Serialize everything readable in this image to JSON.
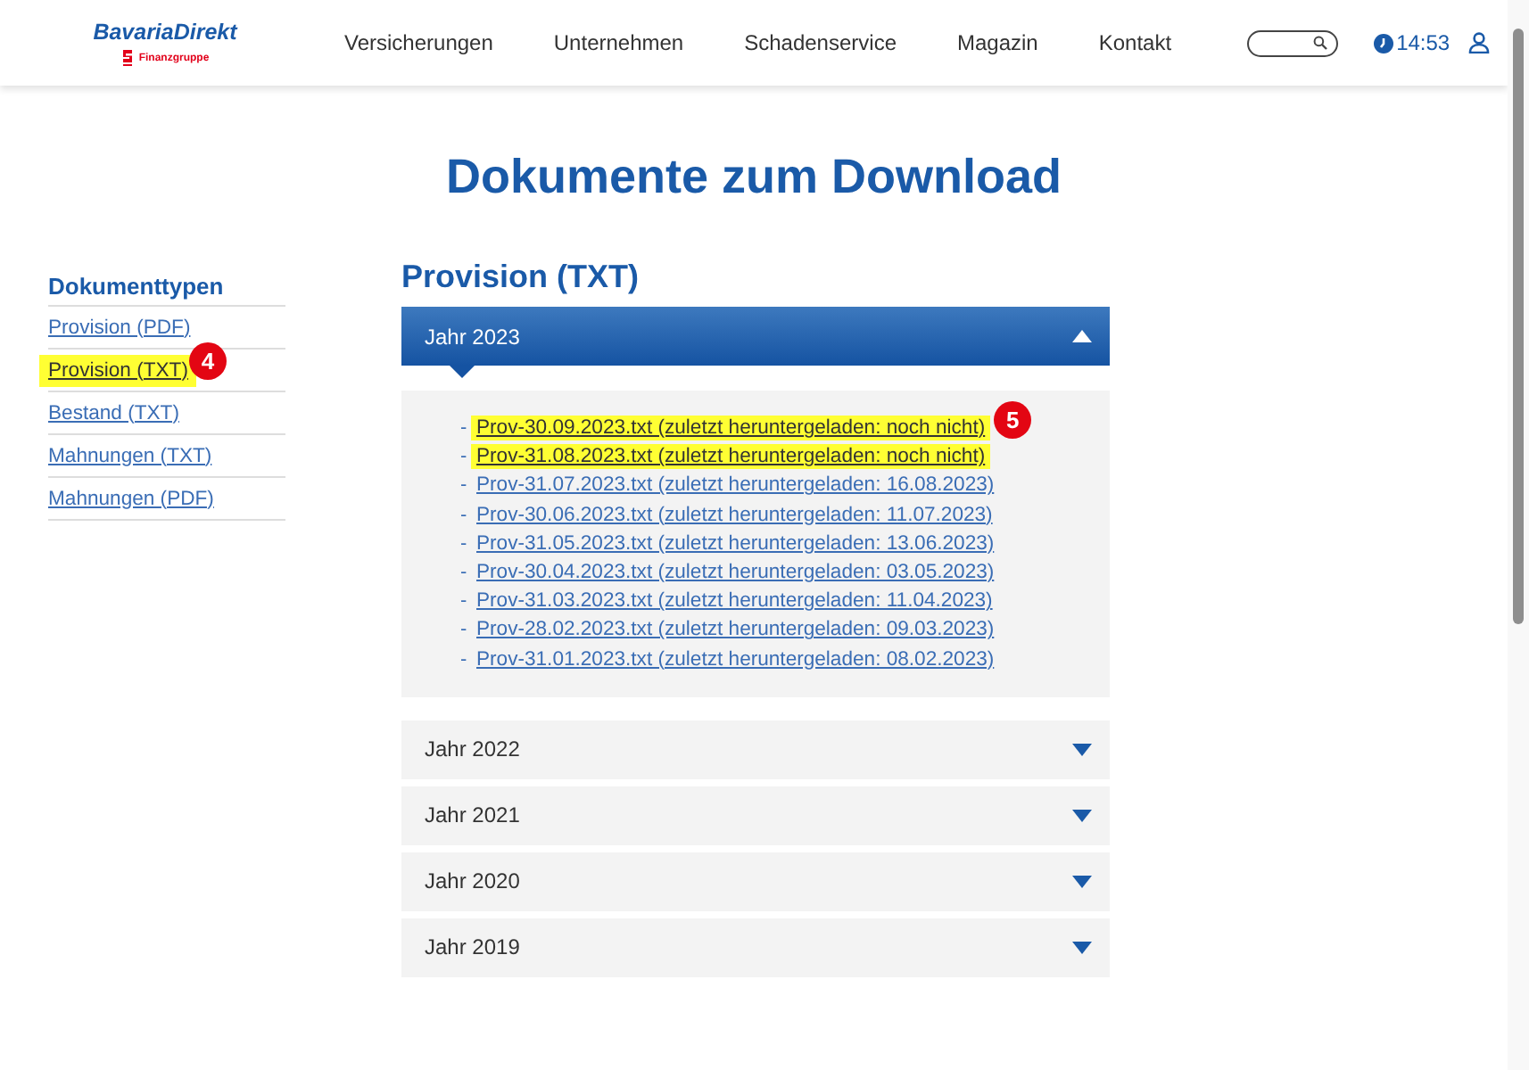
{
  "header": {
    "logo": {
      "name": "BavariaDirekt",
      "sub": "Finanzgruppe"
    },
    "nav": [
      "Versicherungen",
      "Unternehmen",
      "Schadenservice",
      "Magazin",
      "Kontakt"
    ],
    "time": "14:53"
  },
  "title": "Dokumente zum Download",
  "sidebar": {
    "heading": "Dokumenttypen",
    "items": [
      {
        "label": "Provision (PDF)",
        "highlighted": false
      },
      {
        "label": "Provision (TXT)",
        "highlighted": true,
        "badge": "4"
      },
      {
        "label": "Bestand (TXT)",
        "highlighted": false
      },
      {
        "label": "Mahnungen (TXT)",
        "highlighted": false
      },
      {
        "label": "Mahnungen (PDF)",
        "highlighted": false
      }
    ]
  },
  "section_title": "Provision (TXT)",
  "years": [
    {
      "label": "Jahr 2023",
      "expanded": true,
      "marker": "-",
      "files": [
        {
          "label": "Prov-30.09.2023.txt (zuletzt heruntergeladen: noch nicht)",
          "highlighted": true,
          "badge": "5"
        },
        {
          "label": "Prov-31.08.2023.txt (zuletzt heruntergeladen: noch nicht)",
          "highlighted": true
        },
        {
          "label": "Prov-31.07.2023.txt (zuletzt heruntergeladen: 16.08.2023)",
          "highlighted": false
        },
        {
          "label": "Prov-30.06.2023.txt (zuletzt heruntergeladen: 11.07.2023)",
          "highlighted": false
        },
        {
          "label": "Prov-31.05.2023.txt (zuletzt heruntergeladen: 13.06.2023)",
          "highlighted": false
        },
        {
          "label": "Prov-30.04.2023.txt (zuletzt heruntergeladen: 03.05.2023)",
          "highlighted": false
        },
        {
          "label": "Prov-31.03.2023.txt (zuletzt heruntergeladen: 11.04.2023)",
          "highlighted": false
        },
        {
          "label": "Prov-28.02.2023.txt (zuletzt heruntergeladen: 09.03.2023)",
          "highlighted": false
        },
        {
          "label": "Prov-31.01.2023.txt (zuletzt heruntergeladen: 08.02.2023)",
          "highlighted": false
        }
      ]
    },
    {
      "label": "Jahr 2022",
      "expanded": false
    },
    {
      "label": "Jahr 2021",
      "expanded": false
    },
    {
      "label": "Jahr 2020",
      "expanded": false
    },
    {
      "label": "Jahr 2019",
      "expanded": false
    }
  ]
}
